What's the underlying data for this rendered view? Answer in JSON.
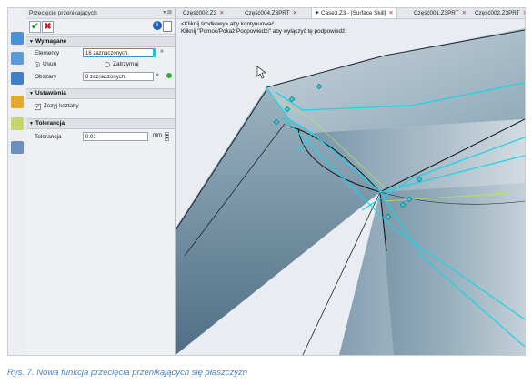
{
  "panel": {
    "title": "Przecięcie przenikających",
    "title_controls": "▾ ⊠",
    "ok_symbol": "✔",
    "cancel_symbol": "✖",
    "info_symbol": "i",
    "sections": {
      "required": "Wymagane",
      "settings": "Ustawienia",
      "tolerance": "Tolerancja"
    },
    "fields": {
      "elements_label": "Elementy",
      "elements_value": "16 zaznaczonych.",
      "remove_label": "Usuń",
      "keep_label": "Zatrzymaj",
      "areas_label": "Obszary",
      "areas_value": "8 zaznaczonych.",
      "stitch_label": "Zszyj kształty",
      "tolerance_label": "Tolerancja",
      "tolerance_value": "0.01",
      "tolerance_unit": "mm"
    }
  },
  "tabs": [
    {
      "label": "Część002.Z3",
      "active": false
    },
    {
      "label": "Część004.Z3PRT",
      "active": false
    },
    {
      "label": "Case3.Z3 - [Surface Skill]",
      "active": true
    },
    {
      "label": "Część001.Z3PRT",
      "active": false
    },
    {
      "label": "Część002.Z3PRT",
      "active": false
    }
  ],
  "tab_close": "✕",
  "viewport": {
    "hint_line1": "<Kliknij środkowy> aby kontynuować.",
    "hint_line2": "Kliknij \"Pomoc/Pokaż Podpowiedzi\" aby wyłączyć tę podpowiedź."
  },
  "caption": "Rys. 7. Nowa funkcja przecięcia przenikających się płaszczyzn",
  "colors": {
    "accent_cyan": "#19d3e6",
    "surface": "#7f9eb0",
    "ok_green": "#2a9d2a",
    "cancel_red": "#d32020",
    "caption_blue": "#4a7fbf"
  }
}
